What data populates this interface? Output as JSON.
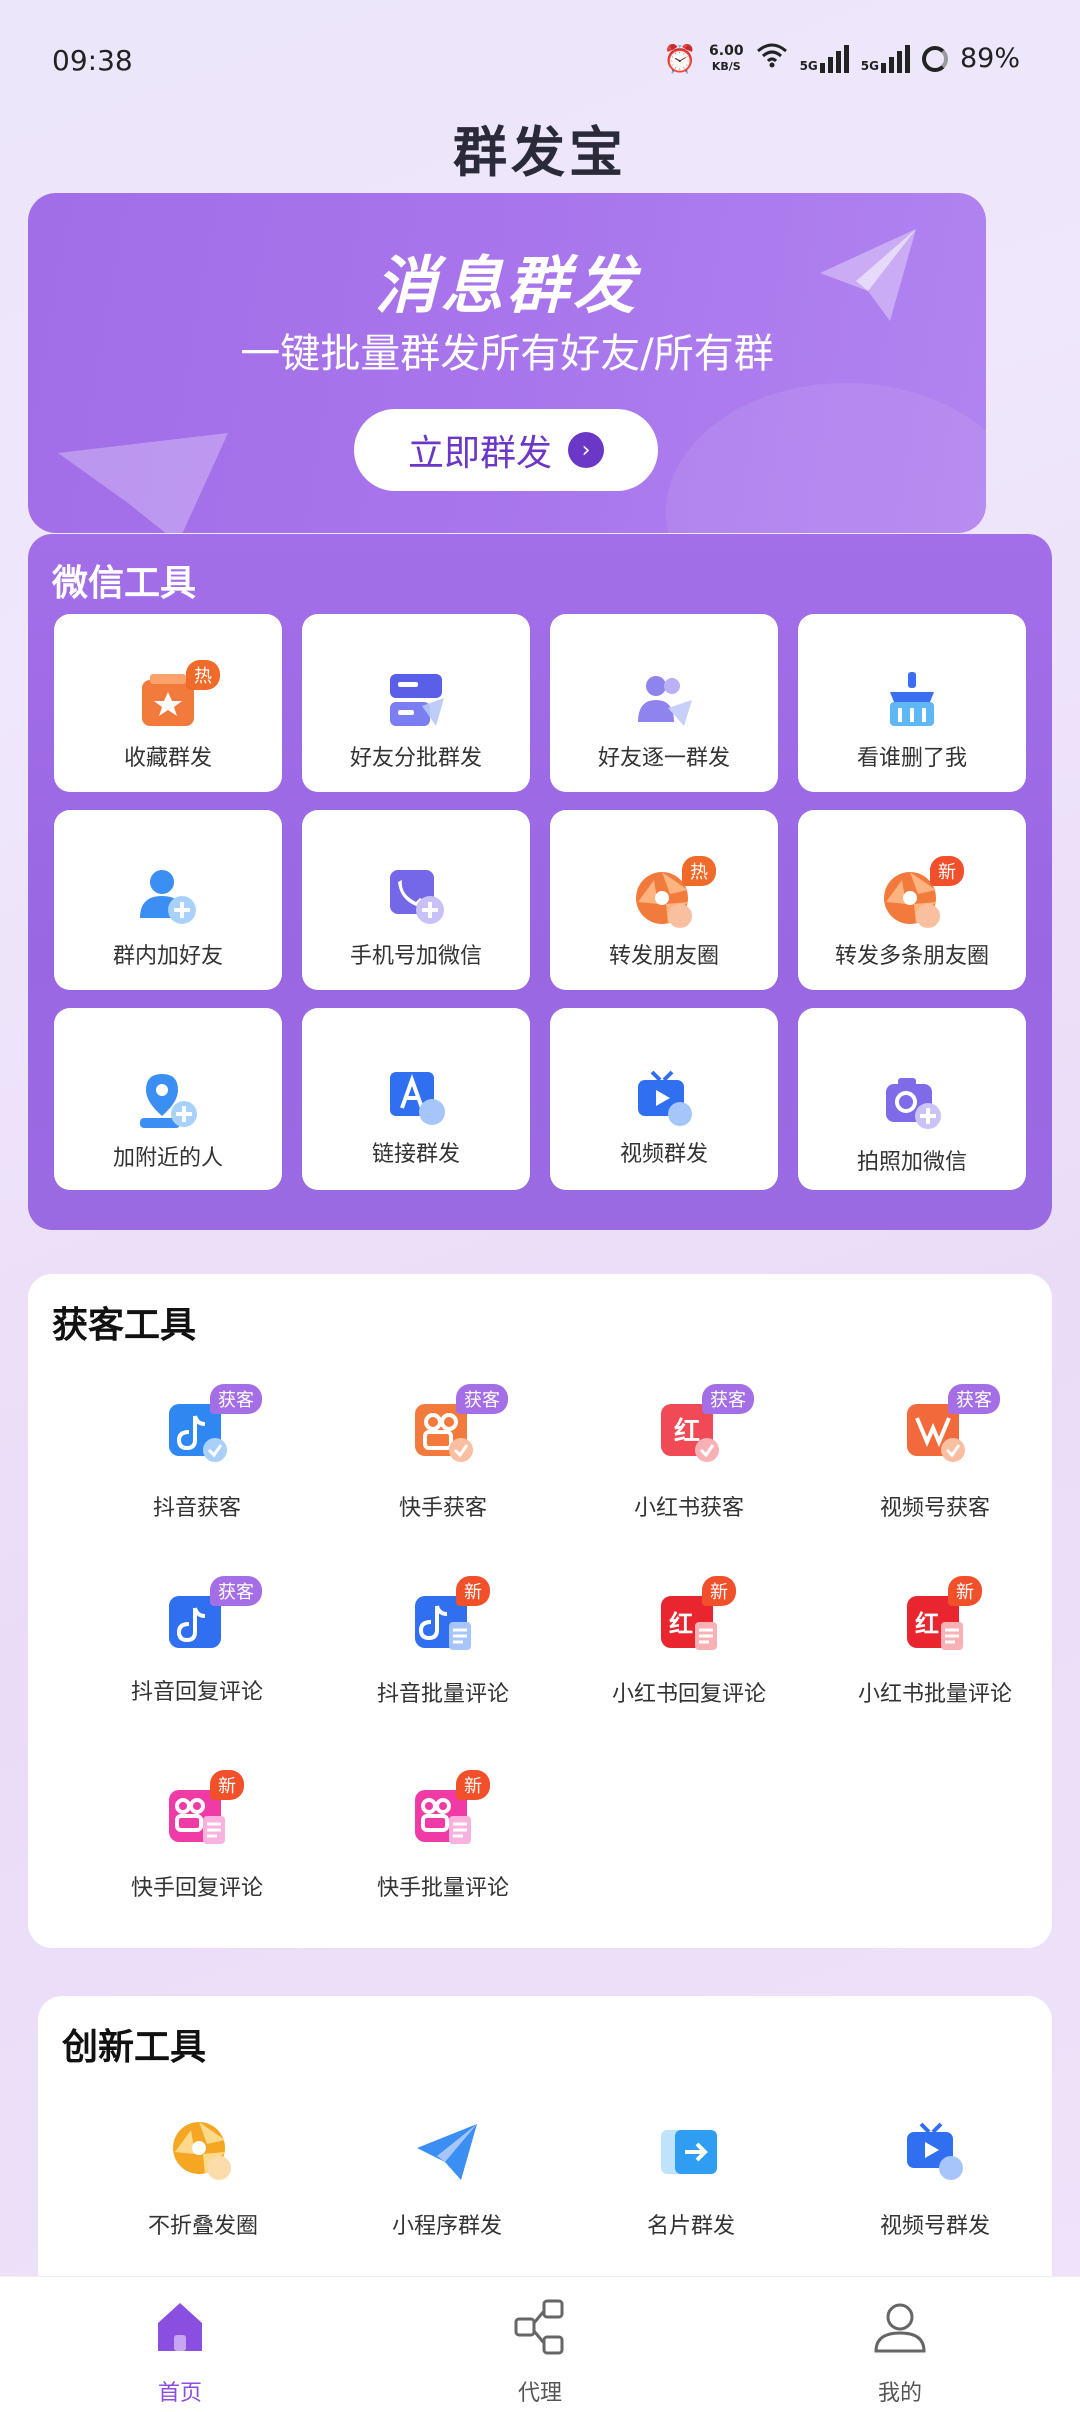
{
  "status": {
    "time": "09:38",
    "net_speed_value": "6.00",
    "net_speed_unit": "KB/S",
    "signal1": "5G",
    "signal2": "5G",
    "battery": "89%"
  },
  "app_title": "群发宝",
  "banner": {
    "headline": "消息群发",
    "subtitle": "一键批量群发所有好友/所有群",
    "cta_label": "立即群发"
  },
  "wechat_tools": {
    "title": "微信工具",
    "items": [
      {
        "label": "收藏群发",
        "badge": "热"
      },
      {
        "label": "好友分批群发",
        "badge": ""
      },
      {
        "label": "好友逐一群发",
        "badge": ""
      },
      {
        "label": "看谁删了我",
        "badge": ""
      },
      {
        "label": "群内加好友",
        "badge": ""
      },
      {
        "label": "手机号加微信",
        "badge": ""
      },
      {
        "label": "转发朋友圈",
        "badge": "热"
      },
      {
        "label": "转发多条朋友圈",
        "badge": "新"
      },
      {
        "label": "加附近的人",
        "badge": ""
      },
      {
        "label": "链接群发",
        "badge": ""
      },
      {
        "label": "视频群发",
        "badge": ""
      },
      {
        "label": "拍照加微信",
        "badge": ""
      }
    ]
  },
  "acquire_tools": {
    "title": "获客工具",
    "items": [
      {
        "label": "抖音获客",
        "badge": "获客"
      },
      {
        "label": "快手获客",
        "badge": "获客"
      },
      {
        "label": "小红书获客",
        "badge": "获客"
      },
      {
        "label": "视频号获客",
        "badge": "获客"
      },
      {
        "label": "抖音回复评论",
        "badge": "获客"
      },
      {
        "label": "抖音批量评论",
        "badge": "新"
      },
      {
        "label": "小红书回复评论",
        "badge": "新"
      },
      {
        "label": "小红书批量评论",
        "badge": "新"
      },
      {
        "label": "快手回复评论",
        "badge": "新"
      },
      {
        "label": "快手批量评论",
        "badge": "新"
      }
    ]
  },
  "innovation_tools": {
    "title": "创新工具",
    "items": [
      {
        "label": "不折叠发圈"
      },
      {
        "label": "小程序群发"
      },
      {
        "label": "名片群发"
      },
      {
        "label": "视频号群发"
      }
    ]
  },
  "tabbar": {
    "items": [
      {
        "label": "首页",
        "active": true
      },
      {
        "label": "代理",
        "active": false
      },
      {
        "label": "我的",
        "active": false
      }
    ]
  },
  "colors": {
    "accent": "#8a4fe0",
    "panel_purple": "#9f6be6",
    "hot_badge": "#f06a2a",
    "acquire_badge": "#a46fe6"
  }
}
